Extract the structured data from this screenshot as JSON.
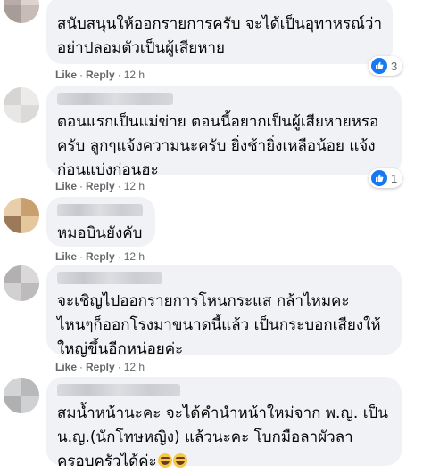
{
  "comments": [
    {
      "text": "สนับสนุนให้ออกรายการครับ จะได้เป็นอุทาหรณ์ว่า\nอย่าปลอมตัวเป็นผู้เสียหาย",
      "like": "Like",
      "reply": "Reply",
      "time": "12 h",
      "reactions": "3",
      "reaction_icon": "thumbs-up-icon"
    },
    {
      "text": "ตอนแรกเป็นแม่ข่าย ตอนนี้อยากเป็นผู้เสียหายหรอ\nครับ ลูกๆแจ้งความนะครับ ยิ่งช้ายิ่งเหลือน้อย แจ้ง\nก่อนแบ่งก่อนฮะ",
      "like": "Like",
      "reply": "Reply",
      "time": "12 h",
      "reactions": "1",
      "reaction_icon": "thumbs-up-icon"
    },
    {
      "text": "หมอบินยังคับ",
      "like": "Like",
      "reply": "Reply",
      "time": "12 h"
    },
    {
      "text": "จะเชิญไปออกรายการโหนกระแส กล้าไหมคะ\nไหนๆก็ออกโรงมาขนาดนี้แล้ว เป็นกระบอกเสียงให้\nใหญ่ขึ้นอีกหน่อยค่ะ",
      "like": "Like",
      "reply": "Reply",
      "time": "12 h"
    },
    {
      "text": "สมน้ำหน้านะคะ จะได้คำนำหน้าใหม่จาก พ.ญ. เป็น\nน.ญ.(นักโทษหญิง) แล้วนะคะ โบกมือลาผัวลา\nครอบครัวได้ค่ะ",
      "emoji_icon": "laughing-emoji-icon"
    }
  ],
  "colors": {
    "bubble": "#f0f2f5",
    "meta": "#65676b",
    "like_blue": "#1877f2"
  }
}
